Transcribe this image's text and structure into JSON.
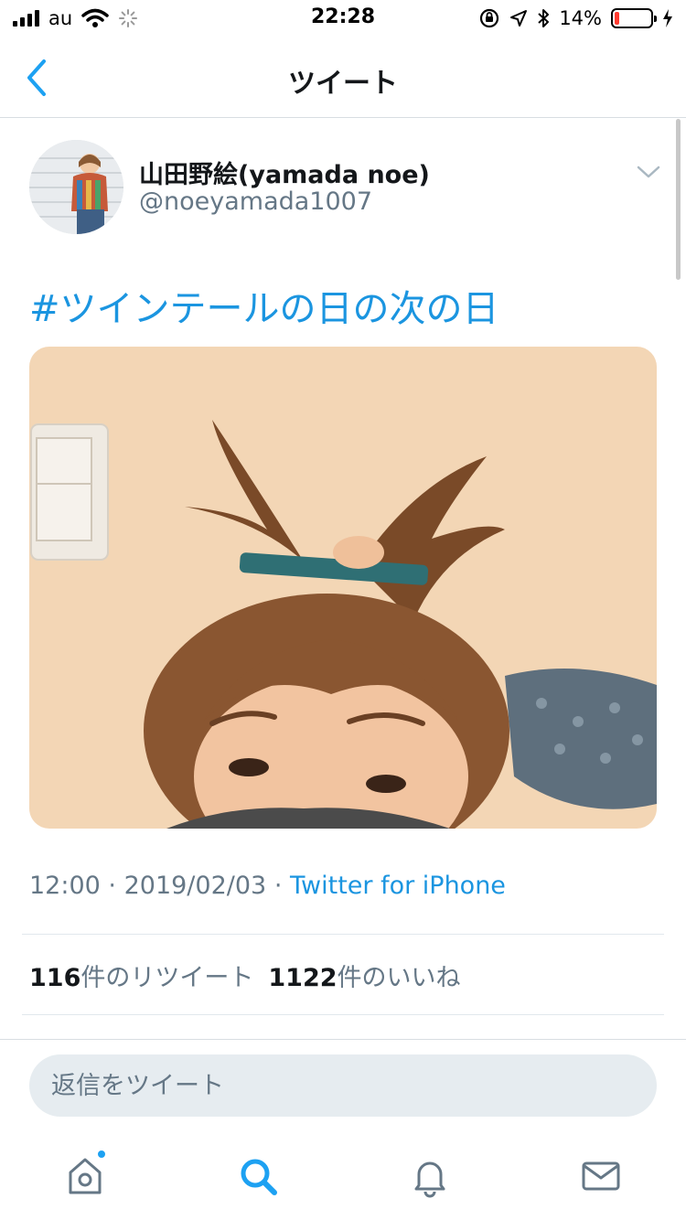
{
  "status_bar": {
    "carrier": "au",
    "time": "22:28",
    "battery_percent": "14%",
    "battery_level": 0.14
  },
  "nav": {
    "title": "ツイート"
  },
  "tweet": {
    "author_name": "山田野絵(yamada noe)",
    "author_handle": "@noeyamada1007",
    "text": "#ツインテールの日の次の日",
    "time": "12:00",
    "separator": "·",
    "date": "2019/02/03",
    "source": "Twitter for iPhone",
    "retweet_count": "116",
    "retweet_label": "件のリツイート",
    "like_count": "1122",
    "like_label": "件のいいね"
  },
  "reply": {
    "placeholder": "返信をツイート"
  },
  "tabs": [
    {
      "icon": "home-icon",
      "active": false,
      "has_badge": true
    },
    {
      "icon": "search-icon",
      "active": true,
      "has_badge": false
    },
    {
      "icon": "bell-icon",
      "active": false,
      "has_badge": false
    },
    {
      "icon": "mail-icon",
      "active": false,
      "has_badge": false
    }
  ],
  "colors": {
    "accent": "#1da1f2",
    "link": "#1b95e0",
    "text_primary": "#14171a",
    "text_secondary": "#657786",
    "battery_low": "#ff3b30"
  }
}
